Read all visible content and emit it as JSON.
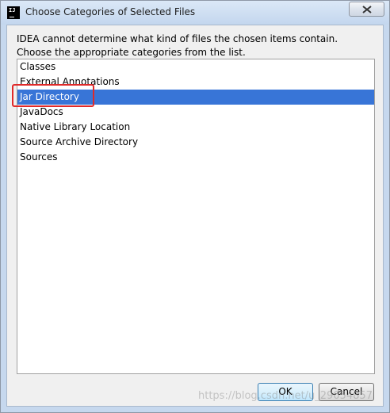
{
  "window": {
    "title": "Choose Categories of Selected Files",
    "app_icon": "intellij-idea-icon",
    "close_icon": "close-icon"
  },
  "message": {
    "line1": "IDEA cannot determine what kind of files the chosen items contain.",
    "line2": "Choose the appropriate categories from the list."
  },
  "categories": {
    "items": [
      {
        "label": "Classes",
        "selected": false
      },
      {
        "label": "External Annotations",
        "selected": false
      },
      {
        "label": "Jar Directory",
        "selected": true
      },
      {
        "label": "JavaDocs",
        "selected": false
      },
      {
        "label": "Native Library Location",
        "selected": false
      },
      {
        "label": "Source Archive Directory",
        "selected": false
      },
      {
        "label": "Sources",
        "selected": false
      }
    ]
  },
  "buttons": {
    "ok_label": "OK",
    "cancel_label": "Cancel"
  },
  "annotation": {
    "highlight_color": "#e02a2a",
    "highlighted_item": "Jar Directory"
  },
  "watermark": {
    "text": "https://blog.csdn.net/u_29054857"
  },
  "colors": {
    "selection": "#3875d7",
    "titlebar": "#cfdff2"
  }
}
